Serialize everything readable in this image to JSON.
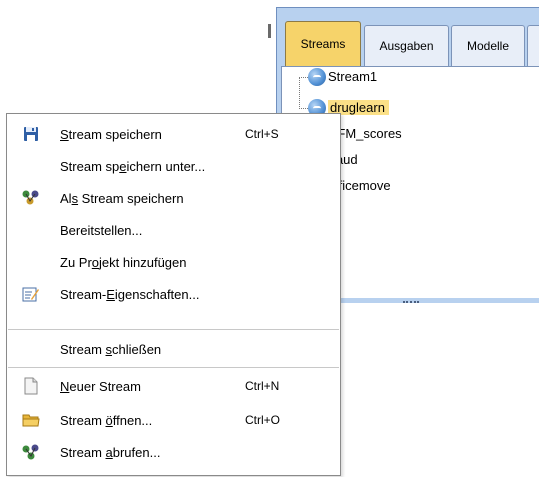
{
  "panel": {
    "tabs": [
      {
        "label": "Streams",
        "active": true
      },
      {
        "label": "Ausgaben",
        "active": false
      },
      {
        "label": "Modelle",
        "active": false
      }
    ],
    "streams": [
      {
        "label": "Stream1",
        "selected": false
      },
      {
        "label": "druglearn",
        "selected": true
      },
      {
        "label": "RFM_scores",
        "selected": false
      },
      {
        "label": "fraud",
        "selected": false
      },
      {
        "label": "officemove",
        "selected": false
      }
    ]
  },
  "menu": {
    "items": [
      {
        "label": "Stream speichern",
        "underline_index": 0,
        "shortcut": "Ctrl+S",
        "icon": "save-icon"
      },
      {
        "label": "Stream speichern unter...",
        "underline_index": 9,
        "shortcut": "",
        "icon": ""
      },
      {
        "label": "Als Stream speichern",
        "underline_index": 2,
        "shortcut": "",
        "icon": "save-as-stream-icon"
      },
      {
        "label": "Bereitstellen...",
        "underline_index": -1,
        "shortcut": "",
        "icon": ""
      },
      {
        "label": "Zu Projekt hinzufügen",
        "underline_index": 5,
        "shortcut": "",
        "icon": ""
      },
      {
        "label": "Stream-Eigenschaften...",
        "underline_index": 7,
        "shortcut": "",
        "icon": "properties-icon"
      },
      {
        "label": "Stream schließen",
        "underline_index": 7,
        "shortcut": "",
        "icon": ""
      },
      {
        "label": "Neuer Stream",
        "underline_index": 0,
        "shortcut": "Ctrl+N",
        "icon": "new-document-icon"
      },
      {
        "label": "Stream öffnen...",
        "underline_index": 7,
        "shortcut": "Ctrl+O",
        "icon": "folder-open-icon"
      },
      {
        "label": "Stream abrufen...",
        "underline_index": 7,
        "shortcut": "",
        "icon": "retrieve-stream-icon"
      }
    ]
  },
  "colors": {
    "panel_bg": "#b8d1ef",
    "active_tab": "#f6d36a",
    "selection": "#fbe087"
  }
}
